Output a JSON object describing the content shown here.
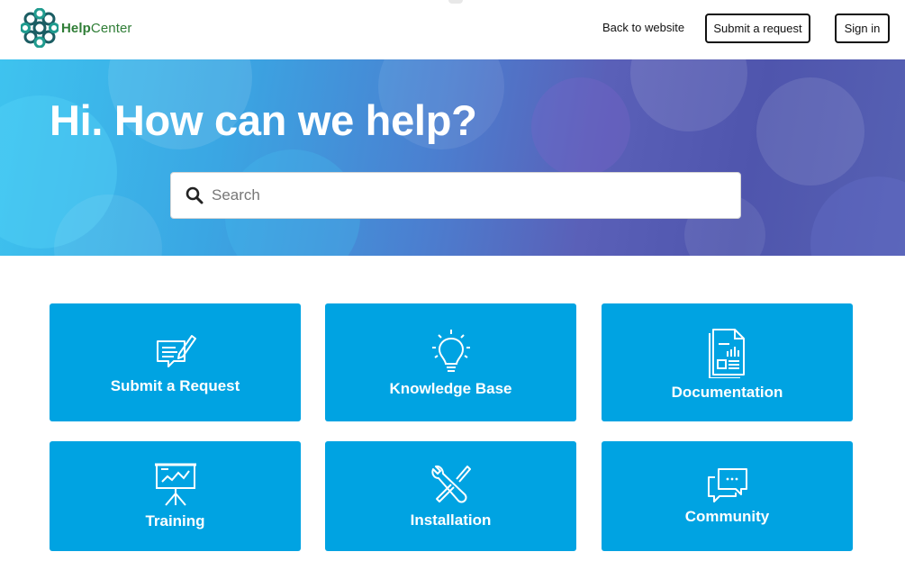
{
  "header": {
    "logo_bold": "Help",
    "logo_light": "Center",
    "back_link": "Back to website",
    "submit_button": "Submit a request",
    "signin_button": "Sign in"
  },
  "hero": {
    "title": "Hi. How can we help?",
    "search_placeholder": "Search"
  },
  "categories": [
    {
      "label": "Submit a Request",
      "icon": "request-form-icon"
    },
    {
      "label": "Knowledge Base",
      "icon": "lightbulb-icon"
    },
    {
      "label": "Documentation",
      "icon": "document-icon"
    },
    {
      "label": "Training",
      "icon": "presentation-board-icon"
    },
    {
      "label": "Installation",
      "icon": "tools-icon"
    },
    {
      "label": "Community",
      "icon": "chat-bubbles-icon"
    }
  ],
  "colors": {
    "card_blue": "#00a3e2",
    "logo_green": "#2f7d36",
    "hero_start": "#3ec3ef",
    "hero_end": "#5661b3"
  }
}
